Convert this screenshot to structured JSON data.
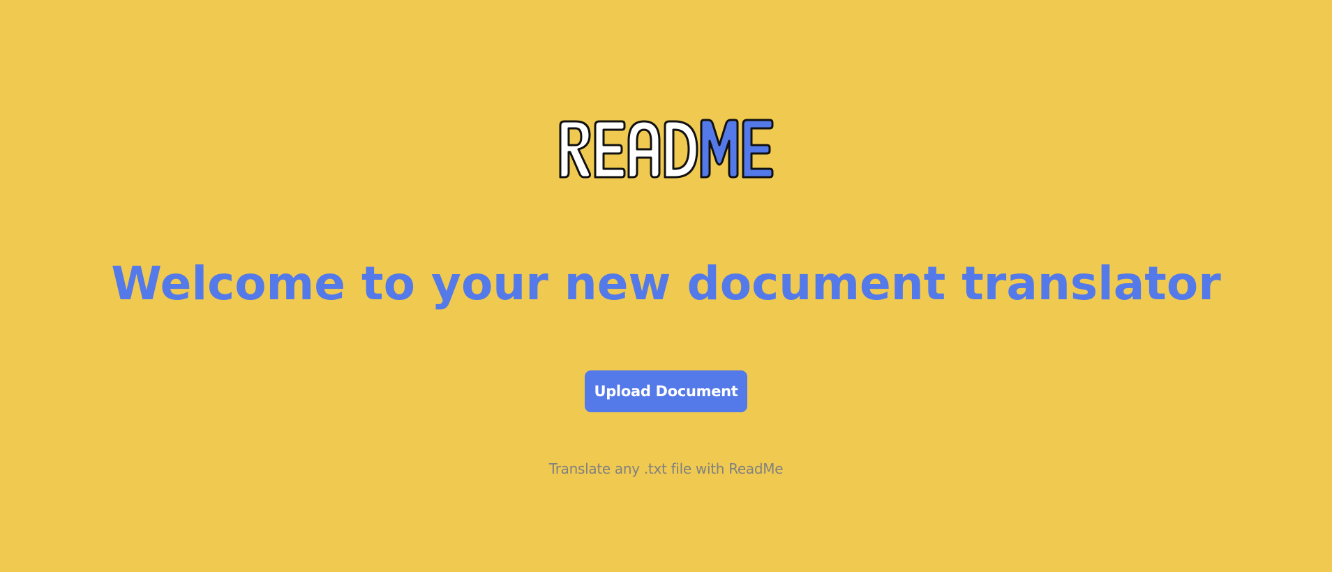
{
  "colors": {
    "background": "#f0ca50",
    "accent": "#5479e9",
    "button_text": "#ffffff",
    "muted_text": "#808080"
  },
  "logo": {
    "text": "READ ME",
    "part_one": "READ",
    "part_two": "ME"
  },
  "hero": {
    "headline": "Welcome to your new document translator"
  },
  "actions": {
    "upload_label": "Upload Document"
  },
  "footer": {
    "tagline": "Translate any .txt file with ReadMe"
  }
}
